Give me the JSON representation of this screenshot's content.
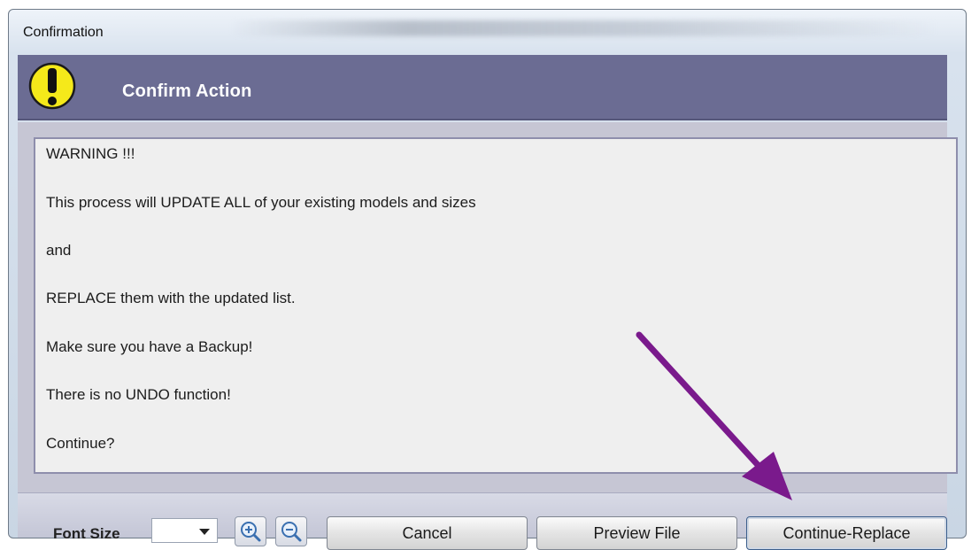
{
  "window": {
    "title": "Confirmation"
  },
  "header": {
    "title": "Confirm Action",
    "icon": "warning-icon",
    "icon_color": "#f5e91a",
    "background_color": "#6b6c93"
  },
  "message": {
    "lines": [
      "WARNING !!!",
      "This process will UPDATE ALL of your existing models and sizes",
      " and",
      "REPLACE them with the updated list.",
      "Make sure you have a Backup!",
      "There is no UNDO function!",
      "Continue?"
    ]
  },
  "bottom_bar": {
    "font_size_label": "Font Size",
    "font_size_value": "",
    "zoom_in_icon": "zoom-in-icon",
    "zoom_out_icon": "zoom-out-icon",
    "cancel_label": "Cancel",
    "preview_label": "Preview File",
    "continue_label": "Continue-Replace"
  },
  "annotation": {
    "arrow_color": "#7a1a8c",
    "points_to": "continue-replace-button"
  }
}
